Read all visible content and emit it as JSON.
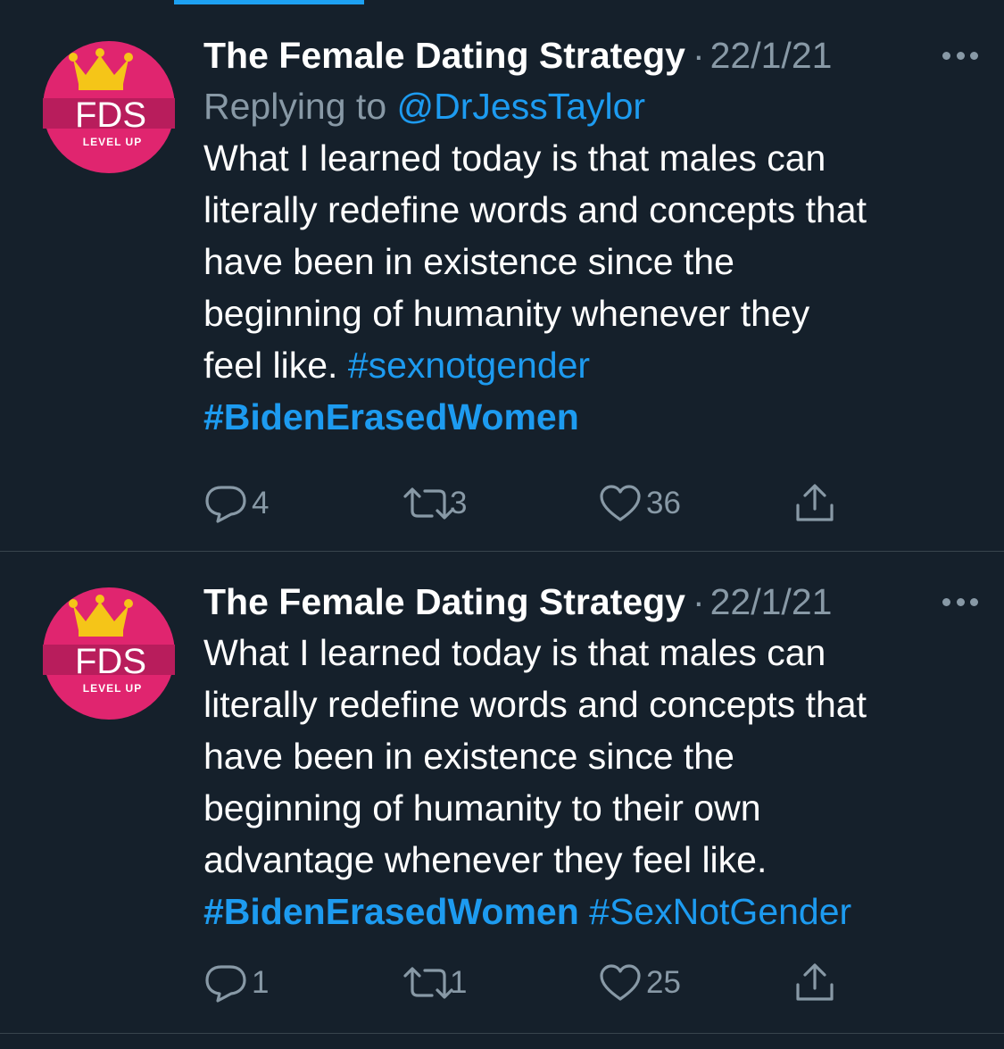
{
  "tweets": [
    {
      "author": "The Female Dating Strategy",
      "separator": "·",
      "date": "22/1/21",
      "replying_prefix": "Replying to ",
      "replying_handle": "@DrJessTaylor",
      "body_lines": [
        "What I learned today is that males can",
        "literally redefine words and concepts that",
        "have been in existence since the",
        "beginning of humanity whenever they",
        "feel like. "
      ],
      "hashtag_inline": "#sexnotgender",
      "hashtag_line": "#BidenErasedWomen",
      "replies": "4",
      "retweets": "3",
      "likes": "36"
    },
    {
      "author": "The Female Dating Strategy",
      "separator": "·",
      "date": "22/1/21",
      "body_lines": [
        "What I learned today is that males can",
        "literally redefine words and concepts that",
        "have been in existence since the",
        "beginning of humanity to their own",
        "advantage whenever they feel like."
      ],
      "hashtag_bold": "#BidenErasedWomen",
      "hashtag_plain": "#SexNotGender",
      "replies": "1",
      "retweets": "1",
      "likes": "25"
    }
  ],
  "avatar": {
    "text": "FDS",
    "subtext": "LEVEL UP",
    "colors": {
      "circle": "#e0256f",
      "band": "#b81d5c",
      "crown": "#f5c518"
    }
  },
  "icons": {
    "reply": "reply-icon",
    "retweet": "retweet-icon",
    "like": "like-icon",
    "share": "share-icon",
    "more": "more-icon"
  },
  "colors": {
    "background": "#15202b",
    "accent": "#1d9bf0",
    "muted": "#8899a6",
    "divider": "#38444d"
  }
}
